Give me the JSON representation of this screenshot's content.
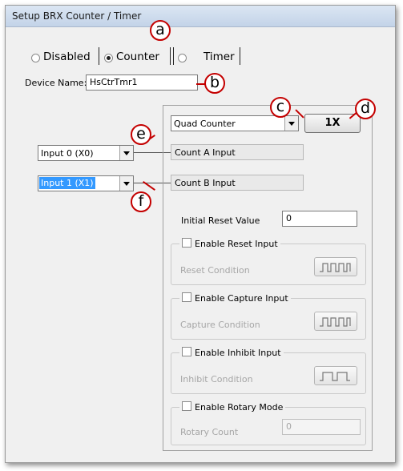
{
  "window": {
    "title": "Setup BRX Counter / Timer"
  },
  "mode_tabs": [
    {
      "label": "Disabled",
      "selected": false
    },
    {
      "label": "Counter",
      "selected": true
    },
    {
      "label": "Timer",
      "selected": false
    }
  ],
  "device": {
    "label": "Device Name:",
    "value": "HsCtrTmr1"
  },
  "counter": {
    "type_value": "Quad Counter",
    "multiplier_label": "1X",
    "count_a_label": "Count A Input",
    "count_b_label": "Count B Input",
    "input_a_value": "Input 0 (X0)",
    "input_b_value": "Input 1 (X1)",
    "initial_reset_label": "Initial Reset Value",
    "initial_reset_value": "0"
  },
  "groups": [
    {
      "title": "Enable Reset Input",
      "label": "Reset Condition",
      "checked": false
    },
    {
      "title": "Enable Capture Input",
      "label": "Capture Condition",
      "checked": false
    },
    {
      "title": "Enable Inhibit Input",
      "label": "Inhibit Condition",
      "checked": false
    },
    {
      "title": "Enable Rotary Mode",
      "label": "Rotary Count",
      "checked": false,
      "value": "0"
    }
  ],
  "callouts": [
    "a",
    "b",
    "c",
    "d",
    "e",
    "f"
  ],
  "colors": {
    "callout": "#c40000",
    "dialog_bg": "#f0f0f0",
    "selection": "#3399ff"
  }
}
